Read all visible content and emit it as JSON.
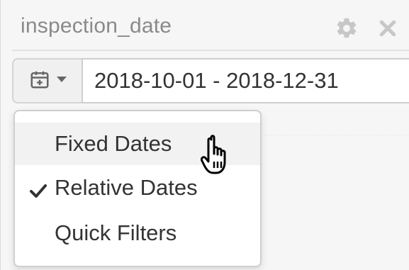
{
  "header": {
    "title": "inspection_date",
    "settings_icon": "gear-icon",
    "close_icon": "close-icon"
  },
  "date_filter": {
    "type_button_icon": "calendar-icon",
    "dropdown_icon": "caret-down-icon",
    "value": "2018-10-01 - 2018-12-31"
  },
  "menu": {
    "items": [
      {
        "label": "Fixed Dates",
        "checked": false,
        "hovered": true
      },
      {
        "label": "Relative Dates",
        "checked": true,
        "hovered": false
      },
      {
        "label": "Quick Filters",
        "checked": false,
        "hovered": false
      }
    ]
  },
  "colors": {
    "panel_background": "#f6f6f6",
    "text": "#333333",
    "muted_text": "#8a8a8a",
    "icon_gray": "#c7c7c7"
  }
}
